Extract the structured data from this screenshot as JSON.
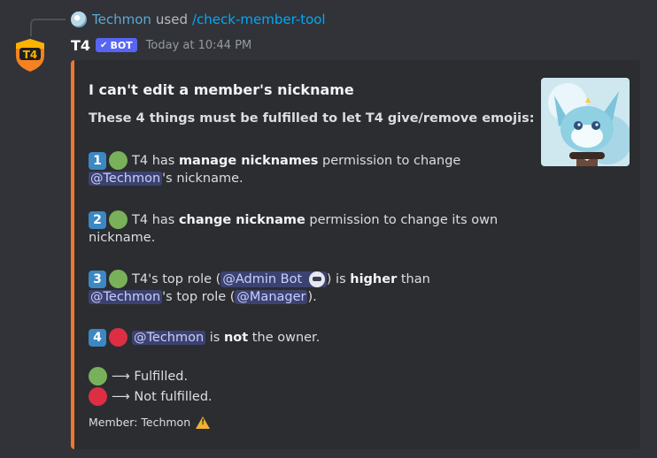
{
  "reply": {
    "user": "Techmon",
    "used_text": "used",
    "command": "/check-member-tool"
  },
  "message": {
    "author": "T4",
    "bot_badge": "BOT",
    "timestamp": "Today at 10:44 PM"
  },
  "embed": {
    "accent_color": "#f1762d",
    "title": "I can't edit a member's nickname",
    "subtitle": "These 4 things must be fulfilled to let T4 give/remove emojis:",
    "items": [
      {
        "number": "1",
        "status": "green",
        "line1_pre": "T4 has ",
        "line1_bold": "manage nicknames",
        "line1_post": " permission to change",
        "line2_mention": "@Techmon",
        "line2_post": "'s nickname."
      },
      {
        "number": "2",
        "status": "green",
        "line1_pre": "T4 has ",
        "line1_bold": "change nickname",
        "line1_post": " permission to change its own",
        "line2": "nickname."
      },
      {
        "number": "3",
        "status": "green",
        "line1_pre": "T4's top role (",
        "line1_role": "@Admin Bot",
        "line1_mid": ") is ",
        "line1_bold": "higher",
        "line1_post": " than",
        "line2_mention": "@Techmon",
        "line2_mid": "'s top role (",
        "line2_role": "@Manager",
        "line2_post": ")."
      },
      {
        "number": "4",
        "status": "red",
        "mention": "@Techmon",
        "pre": " is ",
        "bold": "not",
        "post": " the owner."
      }
    ],
    "legend": [
      {
        "status": "green",
        "text": "⟶ Fulfilled."
      },
      {
        "status": "red",
        "text": "⟶ Not fulfilled."
      }
    ],
    "footer": "Member: Techmon",
    "footer_icon": "warning-icon"
  }
}
